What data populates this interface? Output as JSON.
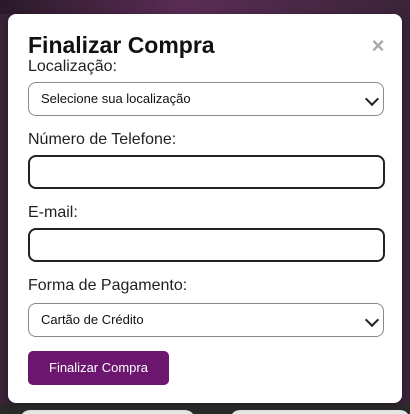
{
  "modal": {
    "title": "Finalizar Compra",
    "close_symbol": "×",
    "location": {
      "label": "Localização:",
      "selected": "Selecione sua localização"
    },
    "phone": {
      "label": "Número de Telefone:",
      "value": ""
    },
    "email": {
      "label": "E-mail:",
      "value": ""
    },
    "payment": {
      "label": "Forma de Pagamento:",
      "selected": "Cartão de Crédito"
    },
    "submit_label": "Finalizar Compra"
  },
  "colors": {
    "accent": "#6d1670",
    "close": "#a9a9a9"
  },
  "icons": {
    "close": "close-icon",
    "dropdown": "chevron-down-icon"
  }
}
